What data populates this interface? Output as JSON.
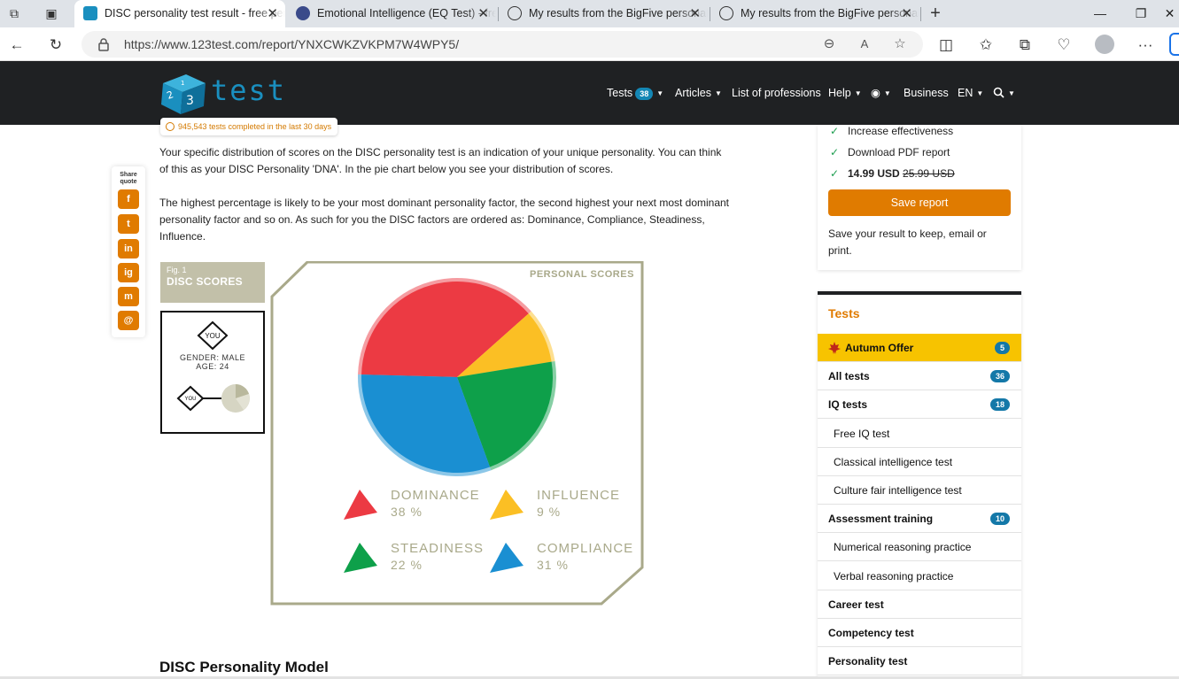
{
  "browser": {
    "tabs": [
      {
        "title": "DISC personality test result - free personality test",
        "active": true
      },
      {
        "title": "Emotional Intelligence (EQ Test) - free",
        "active": false
      },
      {
        "title": "My results from the BigFive personality test",
        "active": false
      },
      {
        "title": "My results from the BigFive personality test",
        "active": false
      }
    ],
    "url": "https://www.123test.com/report/YNXCWKZVKPM7W4WPY5/"
  },
  "site": {
    "logo_text": "test",
    "tests_completed": "945,543 tests completed in the last 30 days",
    "nav": {
      "tests": "Tests",
      "tests_count": "38",
      "articles": "Articles",
      "professions": "List of professions",
      "help": "Help",
      "business": "Business",
      "language": "EN"
    }
  },
  "share": {
    "label": "Share quote",
    "buttons": [
      "f",
      "t",
      "in",
      "ig",
      "m",
      "@"
    ]
  },
  "content": {
    "para1": "Your specific distribution of scores on the DISC personality test is an indication of your unique personality. You can think of this as your DISC Personality 'DNA'. In the pie chart below you see your distribution of scores.",
    "para2": "The highest percentage is likely to be your most dominant personality factor, the second highest your next most dominant personality factor and so on. As such for you the DISC factors are ordered as: Dominance, Compliance, Steadiness, Influence.",
    "fig_num": "Fig. 1",
    "fig_title": "DISC SCORES",
    "you_label": "YOU",
    "gender": "GENDER: MALE",
    "age": "AGE: 24",
    "personal_scores": "PERSONAL SCORES",
    "section_title": "DISC Personality Model"
  },
  "chart_data": {
    "type": "pie",
    "title": "PERSONAL SCORES",
    "series": [
      {
        "name": "DOMINANCE",
        "value": 38,
        "label": "38 %",
        "color": "#ec3a43"
      },
      {
        "name": "INFLUENCE",
        "value": 9,
        "label": "9 %",
        "color": "#fbbf24"
      },
      {
        "name": "STEADINESS",
        "value": 22,
        "label": "22 %",
        "color": "#0ea04a"
      },
      {
        "name": "COMPLIANCE",
        "value": 31,
        "label": "31 %",
        "color": "#1a8fd2"
      }
    ]
  },
  "sidebar": {
    "features": [
      "Increase effectiveness",
      "Download PDF report"
    ],
    "price_new": "14.99 USD",
    "price_old": "25.99 USD",
    "save_button": "Save report",
    "save_note": "Save your result to keep, email or print.",
    "tests_title": "Tests",
    "items": [
      {
        "label": "Autumn Offer",
        "count": "5",
        "kind": "offer"
      },
      {
        "label": "All tests",
        "count": "36",
        "kind": "bold"
      },
      {
        "label": "IQ tests",
        "count": "18",
        "kind": "bold"
      },
      {
        "label": "Free IQ test",
        "count": "",
        "kind": "sub"
      },
      {
        "label": "Classical intelligence test",
        "count": "",
        "kind": "sub"
      },
      {
        "label": "Culture fair intelligence test",
        "count": "",
        "kind": "sub"
      },
      {
        "label": "Assessment training",
        "count": "10",
        "kind": "bold"
      },
      {
        "label": "Numerical reasoning practice",
        "count": "",
        "kind": "sub"
      },
      {
        "label": "Verbal reasoning practice",
        "count": "",
        "kind": "sub"
      },
      {
        "label": "Career test",
        "count": "",
        "kind": "bold"
      },
      {
        "label": "Competency test",
        "count": "",
        "kind": "bold"
      },
      {
        "label": "Personality test",
        "count": "",
        "kind": "bold"
      }
    ]
  },
  "colors": {
    "accent_orange": "#e07b00",
    "header_dark": "#1f2123",
    "badge_blue": "#1478a8",
    "chart_frame": "#a9a98a"
  }
}
